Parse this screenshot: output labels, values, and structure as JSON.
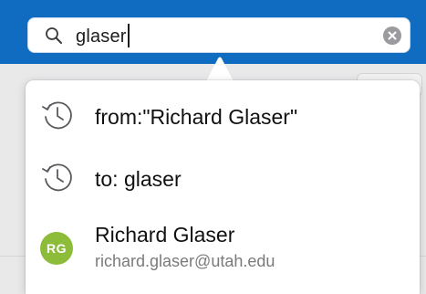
{
  "search": {
    "query": "glaser",
    "icon": "search-icon",
    "clear_icon": "clear-icon"
  },
  "colors": {
    "toolbar": "#0f6cc0",
    "avatar": "#8cbc3a",
    "text": "#111111",
    "secondary_text": "#7a7a7a"
  },
  "suggestions": [
    {
      "type": "history",
      "icon": "history-icon",
      "text": "from:\"Richard Glaser\""
    },
    {
      "type": "history",
      "icon": "history-icon",
      "text": "to: glaser"
    }
  ],
  "contact": {
    "initials": "RG",
    "name": "Richard Glaser",
    "email": "richard.glaser@utah.edu"
  }
}
